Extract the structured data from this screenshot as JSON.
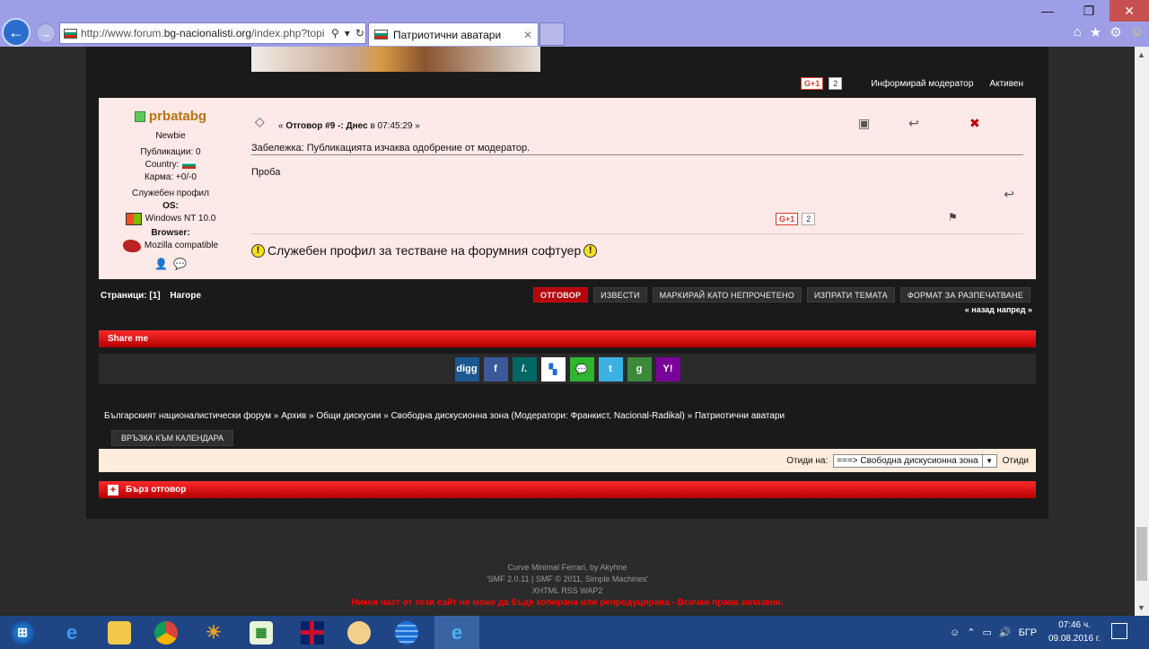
{
  "browser": {
    "url_prefix": "http://www.forum.",
    "url_domain": "bg-nacionalisti.org",
    "url_suffix": "/index.php?topi",
    "tab_title": "Патриотични аватари",
    "window_controls": {
      "minimize": "—",
      "maximize": "❐",
      "close": "✕"
    }
  },
  "previous_post": {
    "gplus_label": "G+1",
    "gplus_count": "2",
    "report_label": "Информирай модератор",
    "status_label": "Активен"
  },
  "post": {
    "author": "prbatabg",
    "rank": "Newbie",
    "posts_label": "Публикации: 0",
    "country_label": "Country:",
    "karma_label": "Карма: +0/-0",
    "custom_title": "Служебен профил",
    "os_label": "OS:",
    "os_value": "Windows NT 10.0",
    "browser_label": "Browser:",
    "browser_value": "Mozilla compatible",
    "reply_prefix": "« ",
    "reply_title": "Отговор #9 -: Днес",
    "reply_time": " в 07:45:29 »",
    "note": "Забележка: Публикацията изчаква одобрение от модератор.",
    "body": "Проба",
    "gplus_label": "G+1",
    "gplus_count": "2",
    "signature": "Служебен профил за тестване на форумния софтуер"
  },
  "pagination": {
    "pages_label": "Страници: [",
    "current_page": "1",
    "pages_close": "]",
    "top_link": "Нагоре",
    "prevnext": "« назад напред »"
  },
  "buttons": {
    "reply": "ОТГОВОР",
    "notify": "ИЗВЕСТИ",
    "mark_unread": "МАРКИРАЙ КАТО НЕПРОЧЕТЕНО",
    "send_topic": "ИЗПРАТИ ТЕМАТА",
    "print": "ФОРМАТ ЗА РАЗПЕЧАТВАНЕ",
    "calendar": "ВРЪЗКА КЪМ КАЛЕНДАРА"
  },
  "share": {
    "title": "Share me",
    "icons": [
      {
        "name": "digg-icon",
        "glyph": "digg",
        "color": "#1b5791"
      },
      {
        "name": "facebook-icon",
        "glyph": "f",
        "color": "#3b5998"
      },
      {
        "name": "slashdot-icon",
        "glyph": "/.",
        "color": "#026664"
      },
      {
        "name": "delicious-icon",
        "glyph": "▚",
        "color": "#ffffff"
      },
      {
        "name": "chat-icon",
        "glyph": "💬",
        "color": "#2fb52f"
      },
      {
        "name": "twitter-icon",
        "glyph": "t",
        "color": "#3db0e5"
      },
      {
        "name": "google-icon",
        "glyph": "g",
        "color": "#3a8a3a"
      },
      {
        "name": "yahoo-icon",
        "glyph": "Y!",
        "color": "#7b0099"
      }
    ]
  },
  "breadcrumb": {
    "items": [
      "Българският националистически форум",
      "Архив",
      "Общи дискусии",
      "Свободна дискусионна зона (Модератори: Франкист, Nacional-Radikal)",
      "Патриотични аватари"
    ],
    "sep": " » "
  },
  "jump": {
    "label": "Отиди на:",
    "selected": "===> Свободна дискусионна зона",
    "go": "Отиди"
  },
  "quick_reply": {
    "title": "Бърз отговор"
  },
  "footer": {
    "theme": "Curve Minimal Ferrari, by Akyhne",
    "smf_version": "SMF 2.0.11",
    "smf_copy": "SMF © 2011",
    "smf_org": "Simple Machines",
    "links": "XHTML   RSS   WAP2",
    "copyright": "Никоя част от този сайт не може да бъде копирана или репродуцирана - Всички права запазени."
  },
  "taskbar": {
    "language": "БГР",
    "time": "07:46 ч.",
    "date": "09.08.2016 г."
  },
  "colors": {
    "accent_red": "#e00000",
    "post_bg": "#fde9e7",
    "author": "#b8740f"
  }
}
